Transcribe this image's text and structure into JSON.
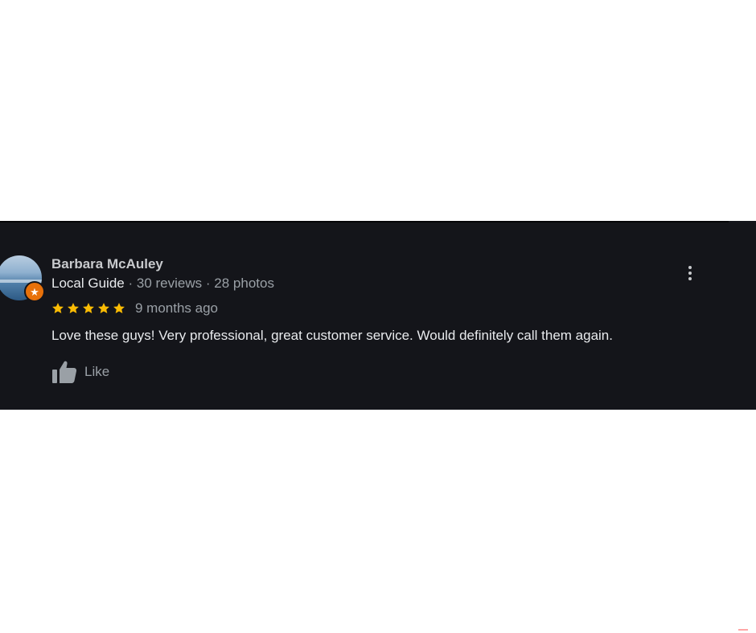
{
  "review": {
    "reviewer_name": "Barbara McAuley",
    "badge": "Local Guide",
    "separator": "·",
    "reviews_count": "30 reviews",
    "photos_count": "28 photos",
    "rating": 5,
    "rating_max": 5,
    "date": "9 months ago",
    "text": "Love these guys!  Very professional,  great customer service.  Would definitely call them again.",
    "like_label": "Like"
  },
  "icons": {
    "guide_badge": "star-badge-icon",
    "star": "star-icon",
    "like": "thumbs-up-icon",
    "more": "more-vert-icon"
  },
  "colors": {
    "card_background": "#14151a",
    "star": "#fbbc04",
    "badge": "#e8710a",
    "primary_text": "#e8eaed",
    "secondary_text": "#9aa0a6"
  }
}
